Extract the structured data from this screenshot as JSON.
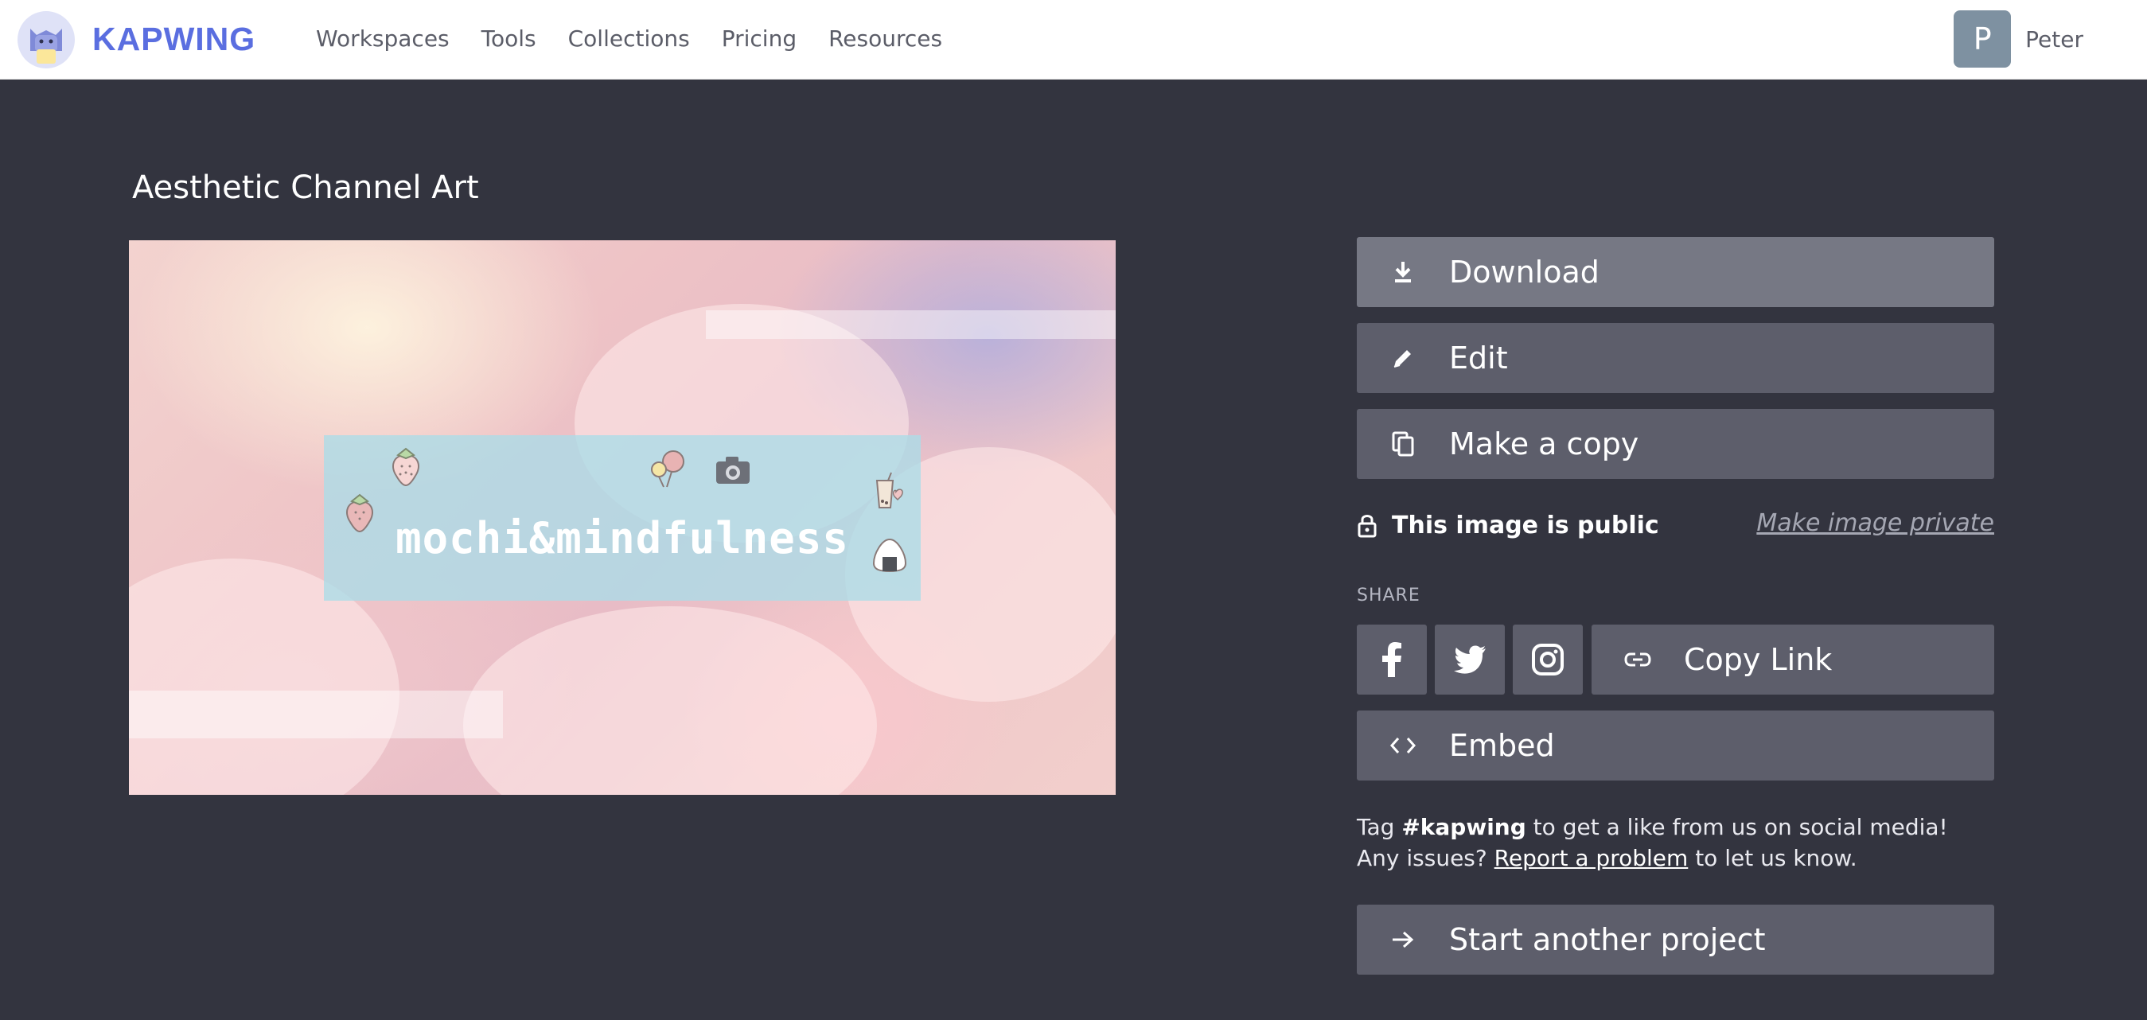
{
  "header": {
    "brand": "KAPWING",
    "nav": [
      "Workspaces",
      "Tools",
      "Collections",
      "Pricing",
      "Resources"
    ],
    "user": {
      "initial": "P",
      "name": "Peter",
      "avatar_color": "#7e91a1"
    }
  },
  "page": {
    "title": "Aesthetic Channel Art"
  },
  "preview": {
    "banner_text": "mochi&mindfulness"
  },
  "actions": {
    "download": "Download",
    "edit": "Edit",
    "copy": "Make a copy",
    "embed": "Embed",
    "start_another": "Start another project"
  },
  "privacy": {
    "status": "This image is public",
    "toggle_link": "Make image private"
  },
  "share": {
    "label": "SHARE",
    "copy_link": "Copy Link",
    "icons": [
      "facebook-icon",
      "twitter-icon",
      "instagram-icon"
    ]
  },
  "note": {
    "pre": "Tag ",
    "hashtag": "#kapwing",
    "mid": " to get a like from us on social media! Any issues? ",
    "link": "Report a problem",
    "post": " to let us know."
  },
  "colors": {
    "background": "#33343f",
    "button": "#5d5e6b",
    "button_primary": "#767884",
    "brand": "#5a6ee0"
  }
}
